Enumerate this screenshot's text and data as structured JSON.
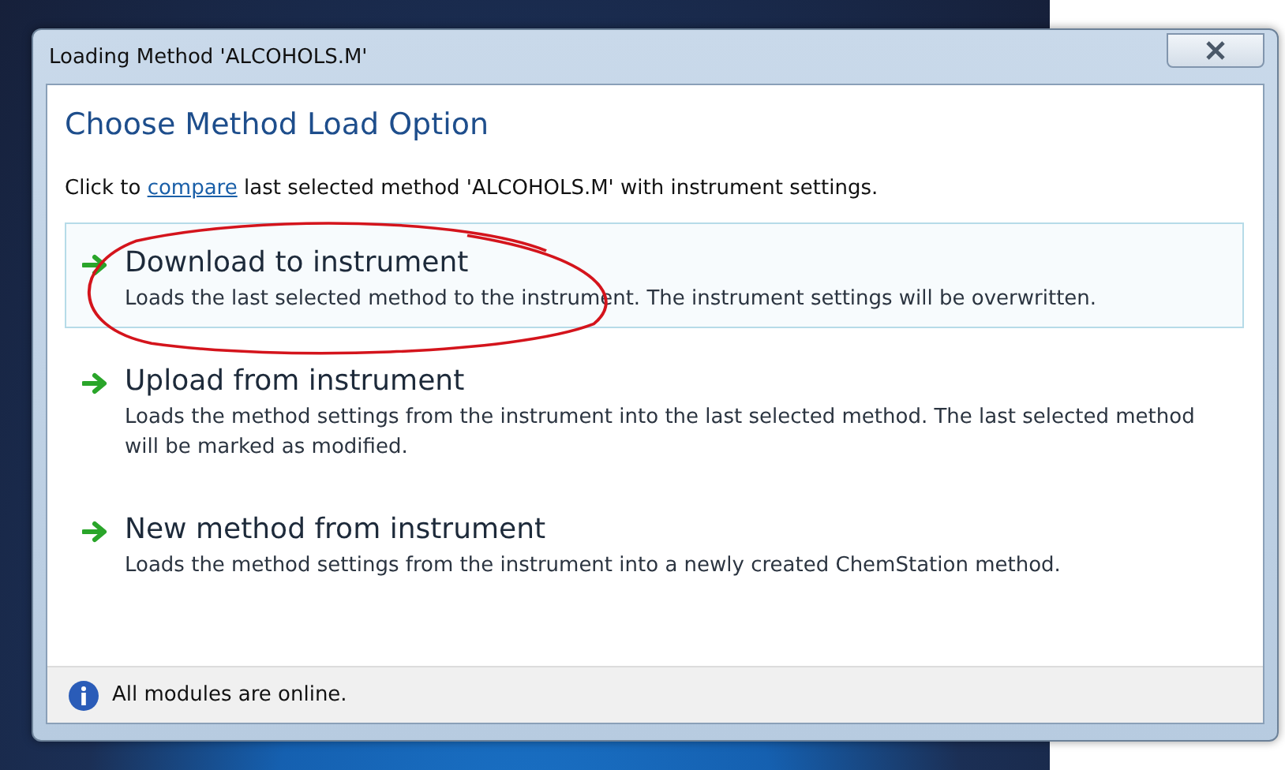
{
  "window": {
    "title": "Loading Method 'ALCOHOLS.M'"
  },
  "heading": "Choose Method Load Option",
  "intro": {
    "before": "Click to",
    "link": "compare",
    "after": "last selected method 'ALCOHOLS.M' with instrument settings."
  },
  "options": [
    {
      "title": "Download to instrument",
      "description": "Loads the last selected method to the instrument. The instrument settings will be overwritten.",
      "selected": true
    },
    {
      "title": "Upload from instrument",
      "description": "Loads the method settings from the instrument into the last selected method. The last selected method will be marked as modified.",
      "selected": false
    },
    {
      "title": "New method from instrument",
      "description": "Loads the method settings from the instrument into a newly created ChemStation method.",
      "selected": false
    }
  ],
  "status_bar": {
    "text": "All modules are online."
  }
}
